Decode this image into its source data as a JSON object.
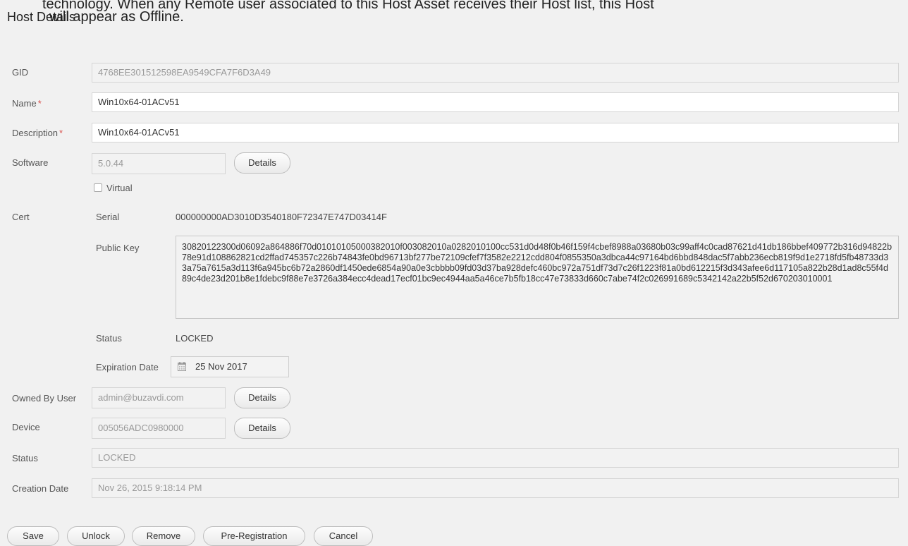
{
  "overlay": {
    "line1": "technology. When any Remote user associated to this Host Asset receives their Host list, this Host",
    "line2": "will appear as Offline."
  },
  "page": {
    "title": "Host Details"
  },
  "form": {
    "gid": {
      "label": "GID",
      "value": "4768EE301512598EA9549CFA7F6D3A49"
    },
    "name": {
      "label": "Name",
      "required_mark": "*",
      "value": "Win10x64-01ACv51"
    },
    "description": {
      "label": "Description",
      "required_mark": "*",
      "value": "Win10x64-01ACv51"
    },
    "software": {
      "label": "Software",
      "value": "5.0.44",
      "details_label": "Details"
    },
    "virtual": {
      "label": "Virtual",
      "checked": false
    },
    "cert": {
      "label": "Cert",
      "serial_label": "Serial",
      "serial_value": "000000000AD3010D3540180F72347E747D03414F",
      "public_key_label": "Public Key",
      "public_key_value": "30820122300d06092a864886f70d01010105000382010f003082010a0282010100cc531d0d48f0b46f159f4cbef8988a03680b03c99aff4c0cad87621d41db186bbef409772b316d94822b78e91d108862821cd2ffad745357c226b74843fe0bd96713bf277be72109cfef7f3582e2212cdd804f0855350a3dbca44c97164bd6bbd848dac5f7abb236ecb819f9d1e2718fd5fb48733d33a75a7615a3d113f6a945bc6b72a2860df1450ede6854a90a0e3cbbbb09fd03d37ba928defc460bc972a751df73d7c26f1223f81a0bd612215f3d343afee6d117105a822b28d1ad8c55f4d89c4de23d201b8e1fdebc9f88e7e3726a384ecc4dead17ecf01bc9ec4944aa5a46ce7b5fb18cc47e73833d660c7abe74f2c026991689c5342142a22b5f52d670203010001",
      "status_label": "Status",
      "status_value": "LOCKED",
      "expiration_label": "Expiration Date",
      "expiration_value": "25 Nov 2017"
    },
    "owned_by": {
      "label": "Owned By User",
      "value": "admin@buzavdi.com",
      "details_label": "Details"
    },
    "device": {
      "label": "Device",
      "value": "005056ADC0980000",
      "details_label": "Details"
    },
    "status": {
      "label": "Status",
      "value": "LOCKED"
    },
    "creation_date": {
      "label": "Creation Date",
      "value": "Nov 26, 2015 9:18:14 PM"
    }
  },
  "actions": {
    "save": "Save",
    "unlock": "Unlock",
    "remove": "Remove",
    "pre_registration": "Pre-Registration",
    "cancel": "Cancel"
  },
  "icons": {
    "calendar": "calendar-icon",
    "checkbox": "checkbox-icon"
  },
  "colors": {
    "required": "#d9534f",
    "background": "#f1f1f1"
  }
}
